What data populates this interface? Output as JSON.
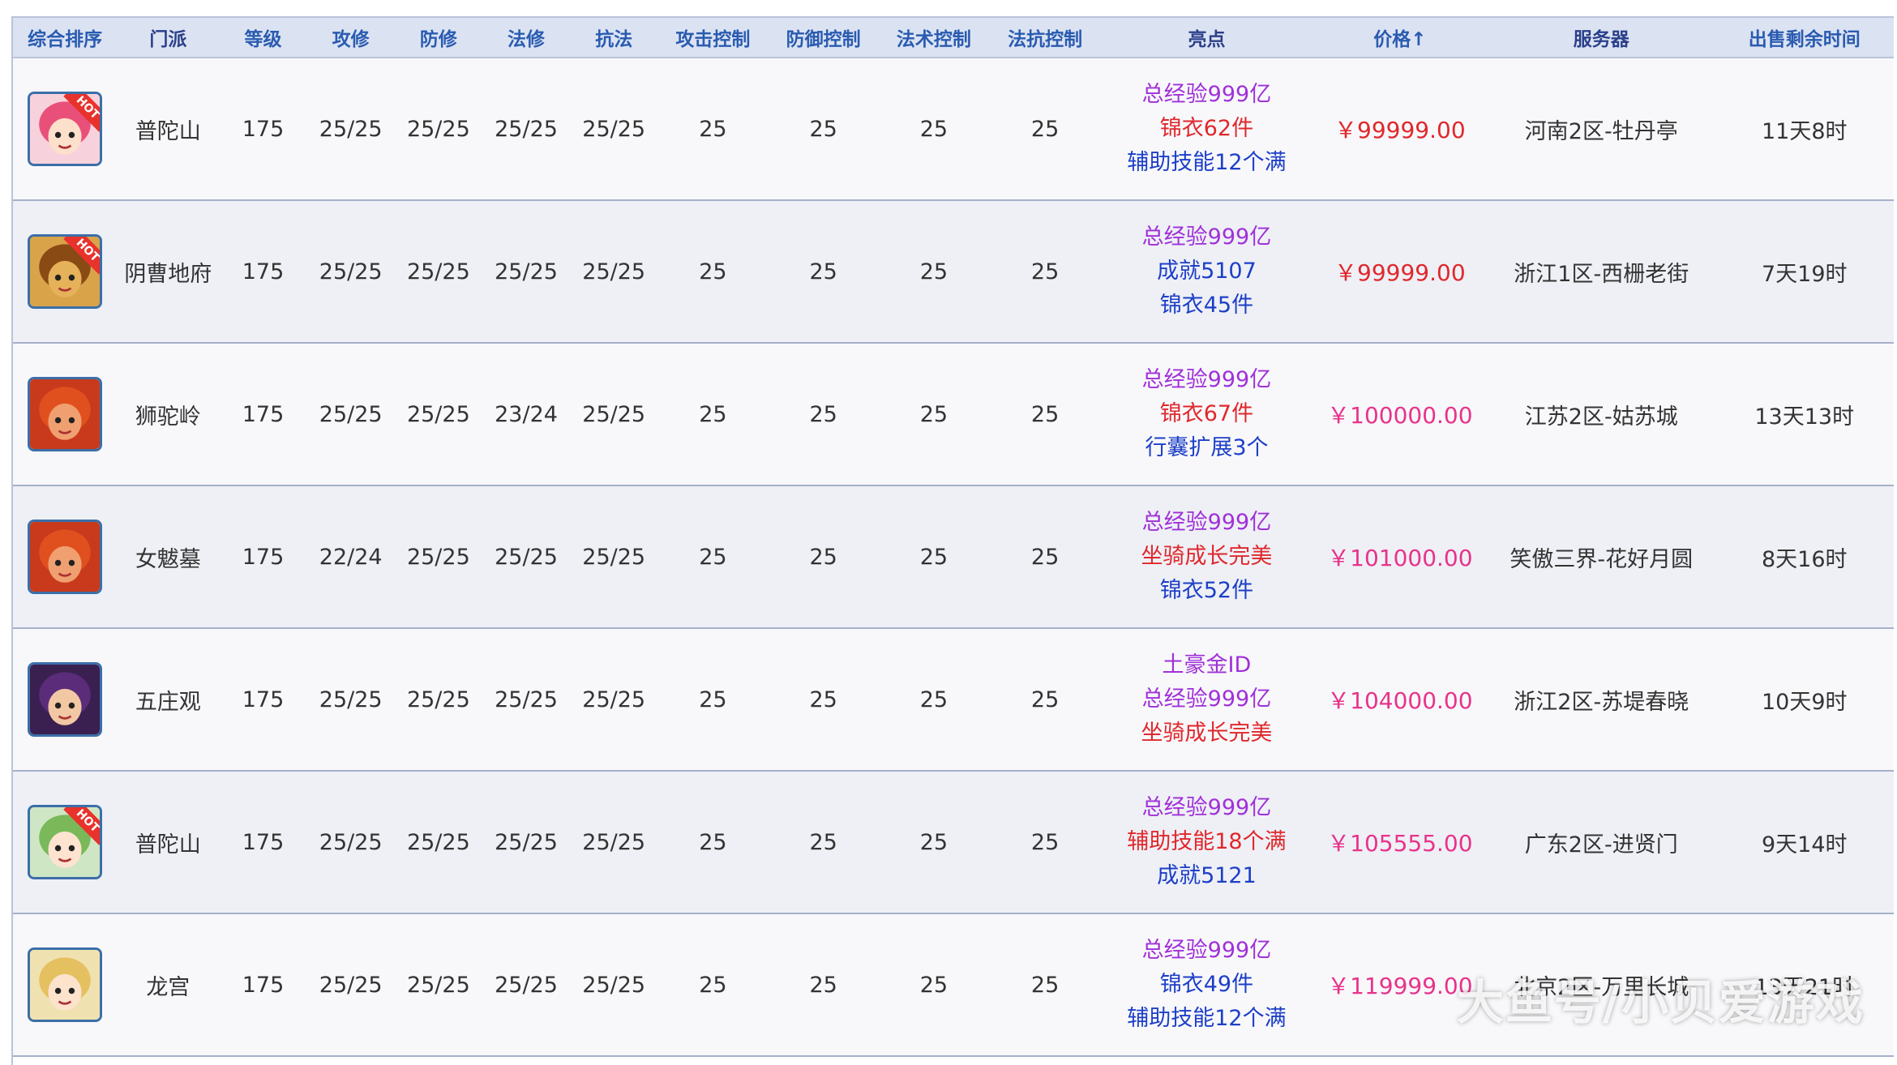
{
  "headers": [
    "综合排序",
    "门派",
    "等级",
    "攻修",
    "防修",
    "法修",
    "抗法",
    "攻击控制",
    "防御控制",
    "法术控制",
    "法抗控制",
    "亮点",
    "价格↑",
    "服务器",
    "出售剩余时间"
  ],
  "colors": {
    "purple": "#a030d8",
    "red": "#e0282c",
    "blue": "#1d3fc7",
    "pink": "#e8338a"
  },
  "rows": [
    {
      "avatar": "putuo-girl-icon",
      "hot": "HOT",
      "faction": "普陀山",
      "level": "175",
      "gx": "25/25",
      "fx": "25/25",
      "fax": "25/25",
      "kf": "25/25",
      "gk": "25",
      "fk": "25",
      "fsk": "25",
      "fkk": "25",
      "highlights": [
        {
          "text": "总经验999亿",
          "color": "purple"
        },
        {
          "text": "锦衣62件",
          "color": "red"
        },
        {
          "text": "辅助技能12个满",
          "color": "blue"
        }
      ],
      "price": "￥99999.00",
      "price_color": "red",
      "server": "河南2区-牡丹亭",
      "time": "11天8时"
    },
    {
      "avatar": "tiger-demon-icon",
      "hot": "HOT",
      "faction": "阴曹地府",
      "level": "175",
      "gx": "25/25",
      "fx": "25/25",
      "fax": "25/25",
      "kf": "25/25",
      "gk": "25",
      "fk": "25",
      "fsk": "25",
      "fkk": "25",
      "highlights": [
        {
          "text": "总经验999亿",
          "color": "purple"
        },
        {
          "text": "成就5107",
          "color": "blue"
        },
        {
          "text": "锦衣45件",
          "color": "blue"
        }
      ],
      "price": "￥99999.00",
      "price_color": "red",
      "server": "浙江1区-西栅老街",
      "time": "7天19时"
    },
    {
      "avatar": "lion-demon-icon",
      "hot": "",
      "faction": "狮驼岭",
      "level": "175",
      "gx": "25/25",
      "fx": "25/25",
      "fax": "23/24",
      "kf": "25/25",
      "gk": "25",
      "fk": "25",
      "fsk": "25",
      "fkk": "25",
      "highlights": [
        {
          "text": "总经验999亿",
          "color": "purple"
        },
        {
          "text": "锦衣67件",
          "color": "red"
        },
        {
          "text": "行囊扩展3个",
          "color": "blue"
        }
      ],
      "price": "￥100000.00",
      "price_color": "pink",
      "server": "江苏2区-姑苏城",
      "time": "13天13时"
    },
    {
      "avatar": "lion-demon-icon",
      "hot": "",
      "faction": "女魃墓",
      "level": "175",
      "gx": "22/24",
      "fx": "25/25",
      "fax": "25/25",
      "kf": "25/25",
      "gk": "25",
      "fk": "25",
      "fsk": "25",
      "fkk": "25",
      "highlights": [
        {
          "text": "总经验999亿",
          "color": "purple"
        },
        {
          "text": "坐骑成长完美",
          "color": "red"
        },
        {
          "text": "锦衣52件",
          "color": "blue"
        }
      ],
      "price": "￥101000.00",
      "price_color": "pink",
      "server": "笑傲三界-花好月圆",
      "time": "8天16时"
    },
    {
      "avatar": "purple-hair-icon",
      "hot": "",
      "faction": "五庄观",
      "level": "175",
      "gx": "25/25",
      "fx": "25/25",
      "fax": "25/25",
      "kf": "25/25",
      "gk": "25",
      "fk": "25",
      "fsk": "25",
      "fkk": "25",
      "highlights": [
        {
          "text": "土豪金ID",
          "color": "purple"
        },
        {
          "text": "总经验999亿",
          "color": "purple"
        },
        {
          "text": "坐骑成长完美",
          "color": "red"
        }
      ],
      "price": "￥104000.00",
      "price_color": "pink",
      "server": "浙江2区-苏堤春晓",
      "time": "10天9时"
    },
    {
      "avatar": "green-hair-icon",
      "hot": "HOT",
      "faction": "普陀山",
      "level": "175",
      "gx": "25/25",
      "fx": "25/25",
      "fax": "25/25",
      "kf": "25/25",
      "gk": "25",
      "fk": "25",
      "fsk": "25",
      "fkk": "25",
      "highlights": [
        {
          "text": "总经验999亿",
          "color": "purple"
        },
        {
          "text": "辅助技能18个满",
          "color": "red"
        },
        {
          "text": "成就5121",
          "color": "blue"
        }
      ],
      "price": "￥105555.00",
      "price_color": "pink",
      "server": "广东2区-进贤门",
      "time": "9天14时"
    },
    {
      "avatar": "blonde-girl-icon",
      "hot": "",
      "faction": "龙宫",
      "level": "175",
      "gx": "25/25",
      "fx": "25/25",
      "fax": "25/25",
      "kf": "25/25",
      "gk": "25",
      "fk": "25",
      "fsk": "25",
      "fkk": "25",
      "highlights": [
        {
          "text": "总经验999亿",
          "color": "purple"
        },
        {
          "text": "锦衣49件",
          "color": "blue"
        },
        {
          "text": "辅助技能12个满",
          "color": "blue"
        }
      ],
      "price": "￥119999.00",
      "price_color": "pink",
      "server": "北京2区-万里长城",
      "time": "13天21时"
    }
  ],
  "watermark": "大鱼号/小贝爱游戏"
}
